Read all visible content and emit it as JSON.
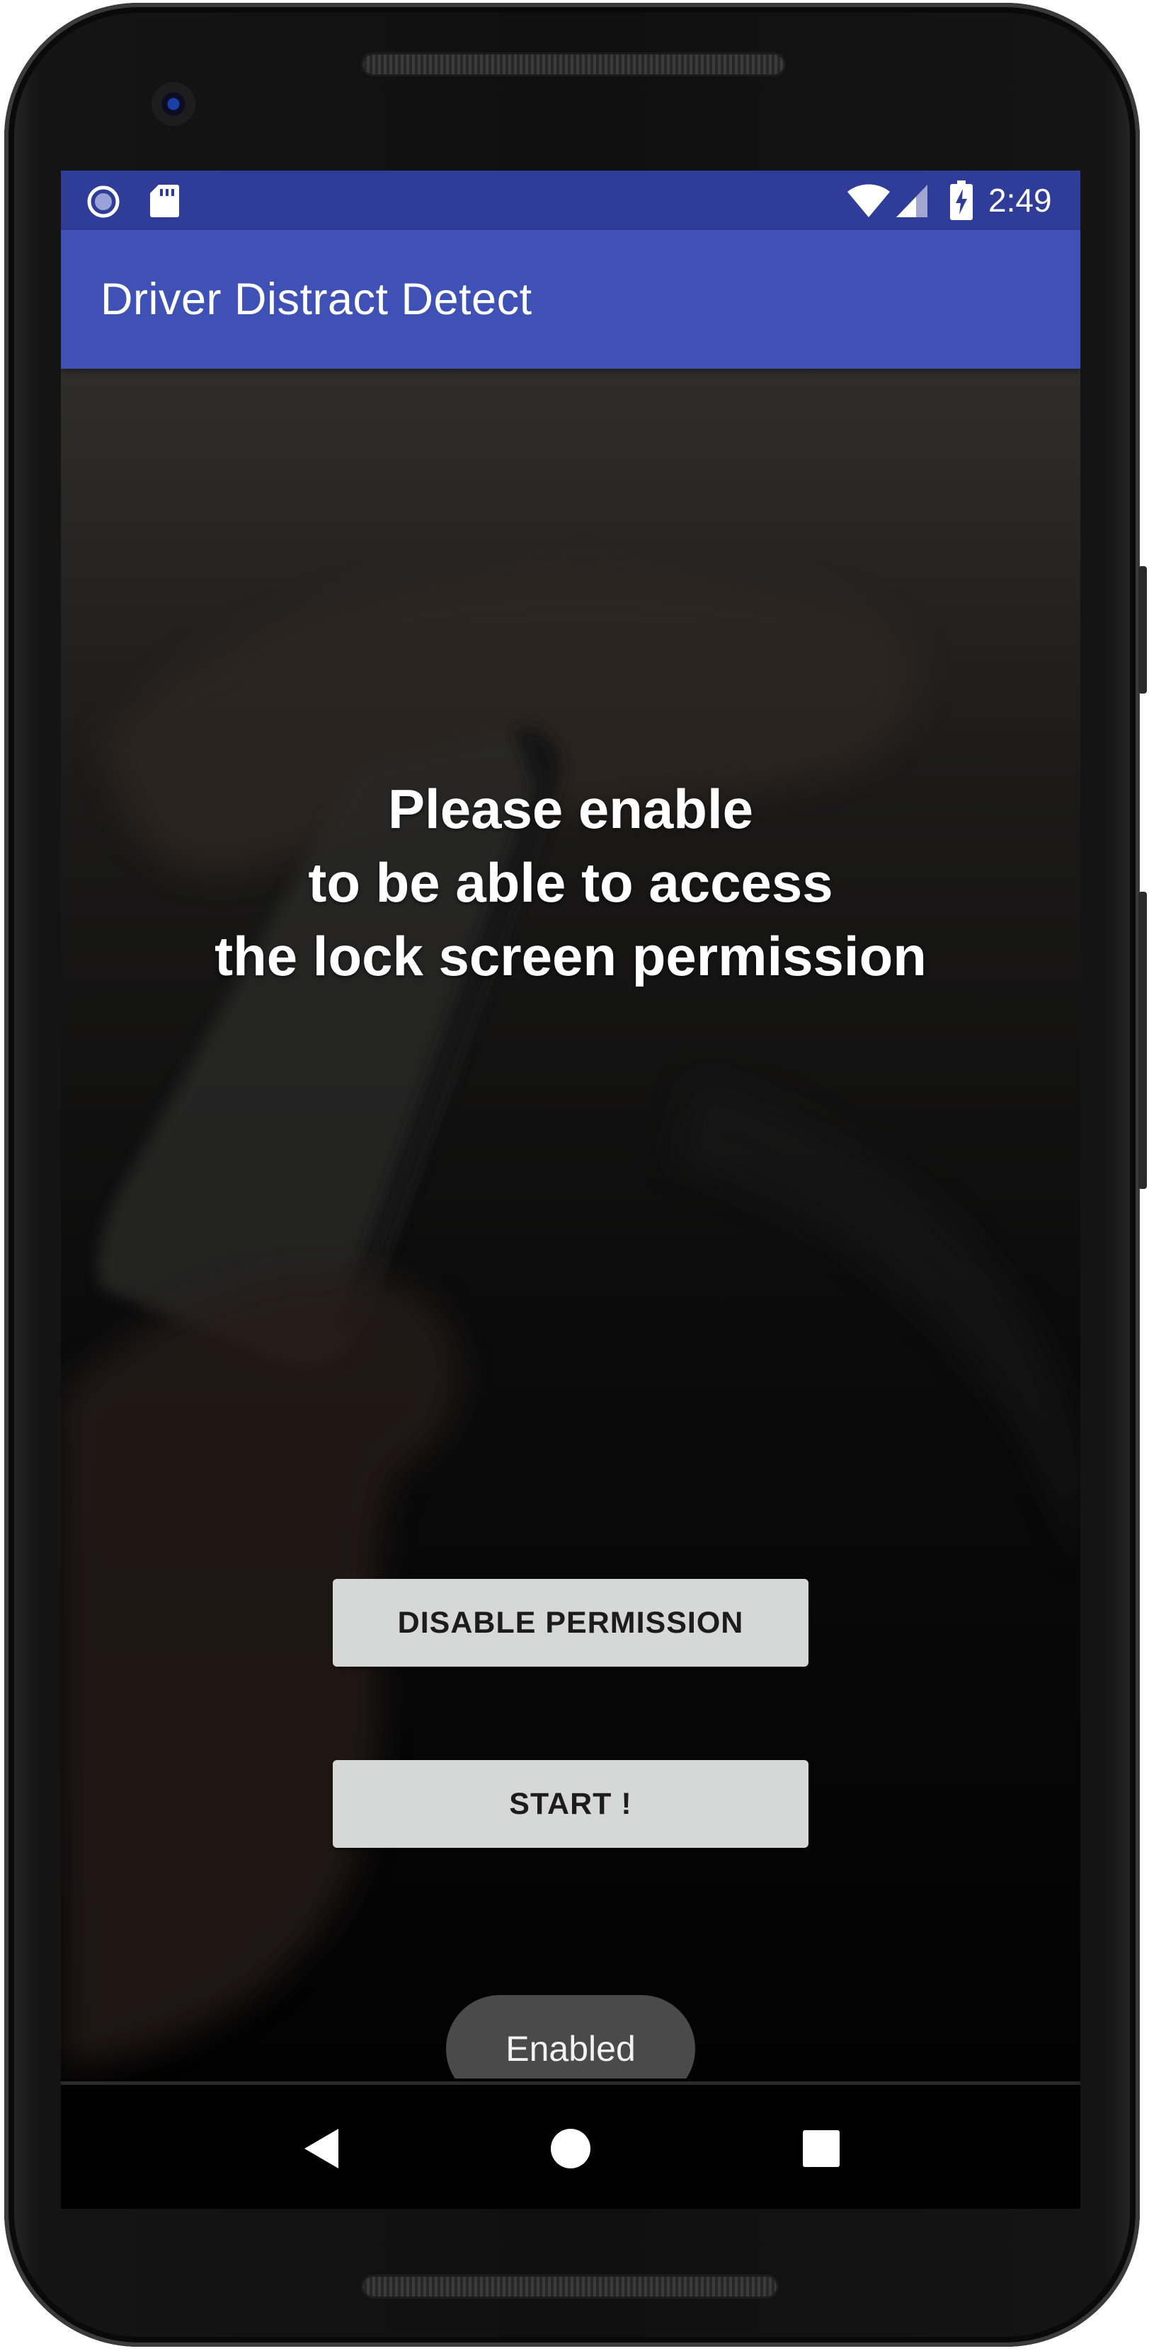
{
  "status_bar": {
    "time": "2:49",
    "left_icons": [
      "sync-circle-icon",
      "sd-card-icon"
    ],
    "right_icons": [
      "wifi-icon",
      "cell-signal-icon",
      "battery-charging-icon"
    ]
  },
  "app_bar": {
    "title": "Driver Distract Detect",
    "color": "#3f51b5",
    "status_color": "#2f3d98"
  },
  "main": {
    "message": "Please enable\nto be able to access\nthe lock screen permission",
    "buttons": {
      "disable_permission": "DISABLE PERMISSION",
      "start": "START !"
    }
  },
  "toast": {
    "text": "Enabled"
  },
  "nav_bar": {
    "icons": [
      "back-icon",
      "home-icon",
      "recents-icon"
    ]
  }
}
